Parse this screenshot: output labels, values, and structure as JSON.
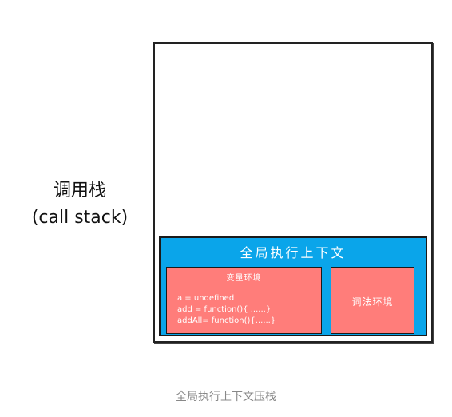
{
  "side_label": {
    "line1": "调用栈",
    "line2": "(call stack)"
  },
  "frame": {
    "title": "全局执行上下文",
    "variable_environment": {
      "title": "变量环境",
      "entries": [
        "a = undefined",
        "add = function(){ ......}",
        "addAll= function(){......}"
      ]
    },
    "lexical_environment": {
      "title": "词法环境"
    }
  },
  "caption": "全局执行上下文压栈",
  "colors": {
    "frame_fill": "#0aa5ea",
    "env_fill": "#ff7d7a",
    "border": "#1a1a1a",
    "caption": "#888888"
  }
}
